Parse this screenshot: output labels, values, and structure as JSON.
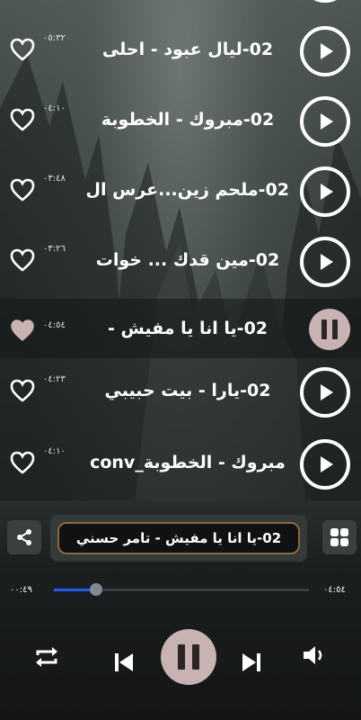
{
  "tracks": [
    {
      "title": "02-ليال عبود - احلى",
      "duration": "٠٥:٣٢",
      "liked": false,
      "state": "idle"
    },
    {
      "title": "02-مبروك - الخطوبة",
      "duration": "٠٤:١٠",
      "liked": false,
      "state": "idle"
    },
    {
      "title": "02-ملحم زين...عرس ال",
      "duration": "٠٣:٤٨",
      "liked": false,
      "state": "idle"
    },
    {
      "title": "02-مين قدك ... خوات",
      "duration": "٠٣:٢٦",
      "liked": false,
      "state": "idle"
    },
    {
      "title": "02-يا انا يا مفيش -",
      "duration": "٠٤:٥٤",
      "liked": true,
      "state": "playing"
    },
    {
      "title": "02-يارا - بيت حبيبي",
      "duration": "٠٤:٢٣",
      "liked": false,
      "state": "idle"
    },
    {
      "title": "مبروك - الخطوبة_conv",
      "duration": "٠٤:١٠",
      "liked": false,
      "state": "idle"
    }
  ],
  "player": {
    "now_playing": "02-يا انا يا مفيش - تامر حسني",
    "elapsed": "٠٠:٤٩",
    "total": "٠٤:٥٤",
    "progress": 0.166
  },
  "icons": {
    "share": "share-icon",
    "grid": "grid-icon",
    "repeat": "repeat-icon",
    "previous": "skip-previous-icon",
    "pause": "pause-icon",
    "next": "skip-next-icon",
    "volume": "volume-icon",
    "heart": "heart-icon",
    "play": "play-icon"
  },
  "colors": {
    "accent_progress": "#1e5bff",
    "pause_button": "#c9b2b2",
    "now_playing_border": "#8a6a3a"
  }
}
